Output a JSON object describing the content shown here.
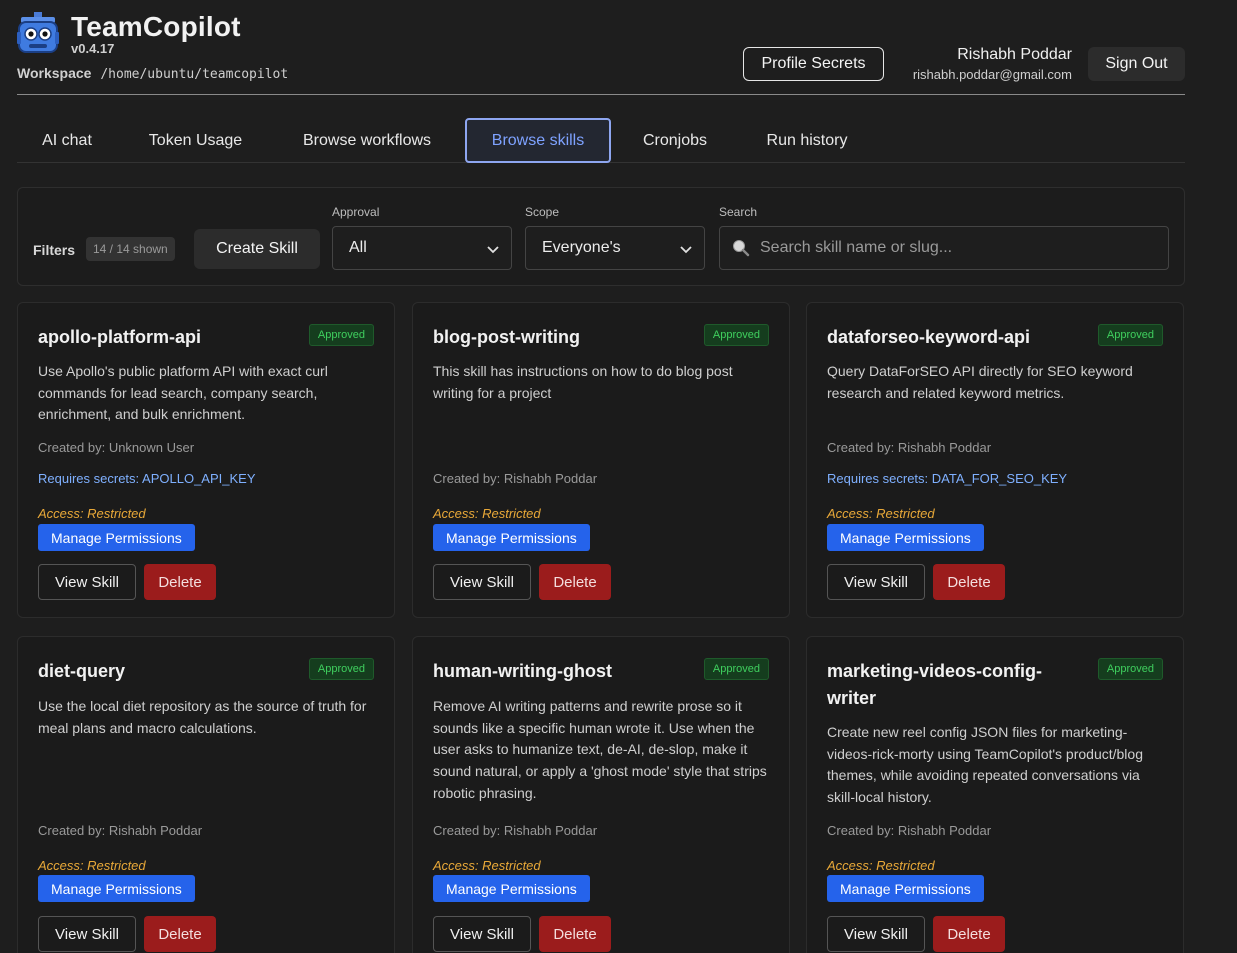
{
  "app": {
    "title": "TeamCopilot",
    "version": "v0.4.17"
  },
  "workspace": {
    "label": "Workspace",
    "path": "/home/ubuntu/teamcopilot"
  },
  "header": {
    "profile_secrets_label": "Profile Secrets",
    "user_name": "Rishabh Poddar",
    "user_email": "rishabh.poddar@gmail.com",
    "sign_out_label": "Sign Out"
  },
  "tabs": [
    {
      "label": "AI chat"
    },
    {
      "label": "Token Usage"
    },
    {
      "label": "Browse workflows"
    },
    {
      "label": "Browse skills",
      "active": true
    },
    {
      "label": "Cronjobs"
    },
    {
      "label": "Run history"
    }
  ],
  "filters": {
    "label": "Filters",
    "shown": "14 / 14 shown",
    "create_label": "Create Skill",
    "approval": {
      "label": "Approval",
      "value": "All"
    },
    "scope": {
      "label": "Scope",
      "value": "Everyone's"
    },
    "search": {
      "label": "Search",
      "placeholder": "Search skill name or slug..."
    }
  },
  "card_common": {
    "access": "Access: Restricted",
    "manage_label": "Manage Permissions",
    "view_label": "View Skill",
    "delete_label": "Delete"
  },
  "skills": [
    {
      "name": "apollo-platform-api",
      "status": "Approved",
      "description": "Use Apollo's public platform API with exact curl commands for lead search, company search, enrichment, and bulk enrichment.",
      "created_by": "Created by: Unknown User",
      "secrets": "Requires secrets: APOLLO_API_KEY"
    },
    {
      "name": "blog-post-writing",
      "status": "Approved",
      "description": "This skill has instructions on how to do blog post writing for a project",
      "created_by": "Created by: Rishabh Poddar",
      "secrets": ""
    },
    {
      "name": "dataforseo-keyword-api",
      "status": "Approved",
      "description": "Query DataForSEO API directly for SEO keyword research and related keyword metrics.",
      "created_by": "Created by: Rishabh Poddar",
      "secrets": "Requires secrets: DATA_FOR_SEO_KEY"
    },
    {
      "name": "diet-query",
      "status": "Approved",
      "description": "Use the local diet repository as the source of truth for meal plans and macro calculations.",
      "created_by": "Created by: Rishabh Poddar",
      "secrets": ""
    },
    {
      "name": "human-writing-ghost",
      "status": "Approved",
      "description": "Remove AI writing patterns and rewrite prose so it sounds like a specific human wrote it. Use when the user asks to humanize text, de-AI, de-slop, make it sound natural, or apply a 'ghost mode' style that strips robotic phrasing.",
      "created_by": "Created by: Rishabh Poddar",
      "secrets": ""
    },
    {
      "name": "marketing-videos-config-writer",
      "status": "Approved",
      "description": "Create new reel config JSON files for marketing-videos-rick-morty using TeamCopilot's product/blog themes, while avoiding repeated conversations via skill-local history.",
      "created_by": "Created by: Rishabh Poddar",
      "secrets": ""
    }
  ]
}
